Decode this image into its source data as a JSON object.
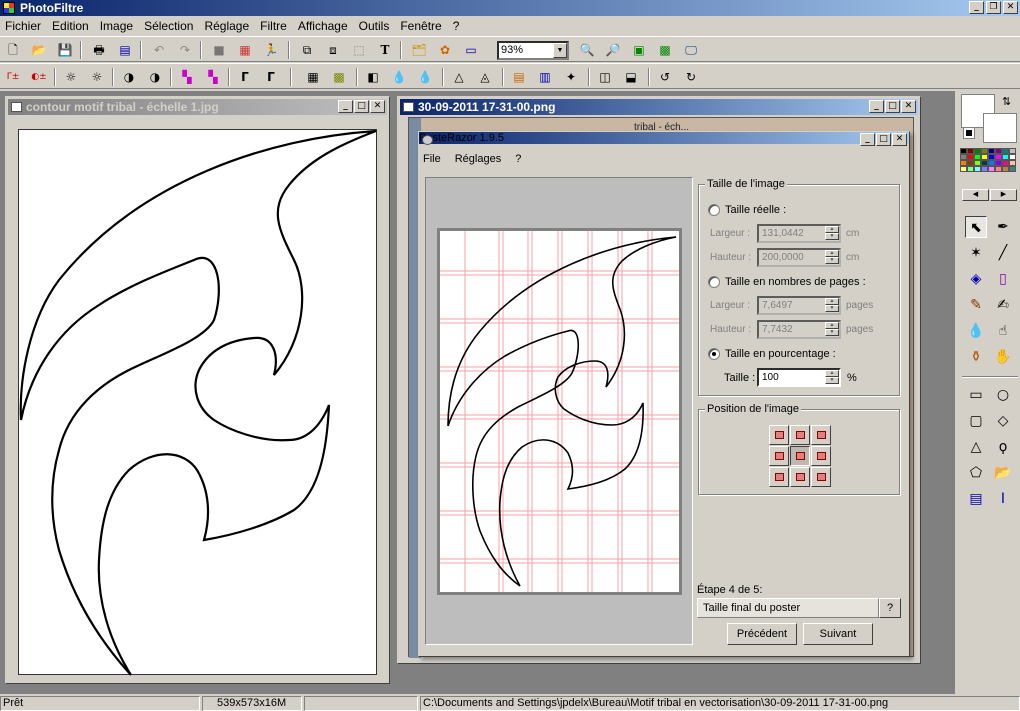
{
  "app": {
    "title": "PhotoFiltre"
  },
  "menu": [
    "Fichier",
    "Edition",
    "Image",
    "Sélection",
    "Réglage",
    "Filtre",
    "Affichage",
    "Outils",
    "Fenêtre",
    "?"
  ],
  "toolbar": {
    "zoom": "93%"
  },
  "windows": {
    "left": {
      "title": "contour motif tribal - échelle 1.jpg"
    },
    "right": {
      "title": "30-09-2011 17-31-00.png",
      "behind_text": "tribal - éch..."
    }
  },
  "posterazor": {
    "title": "PosteRazor 1.9.5",
    "menu": [
      "File",
      "Réglages",
      "?"
    ],
    "size_group": {
      "label": "Taille de l'image",
      "real_size": "Taille réelle :",
      "width_label": "Largeur :",
      "width_value": "131,0442",
      "width_unit": "cm",
      "height_label": "Hauteur :",
      "height_value": "200,0000",
      "height_unit": "cm",
      "pages_size": "Taille en nombres de pages :",
      "pages_width_label": "Largeur :",
      "pages_width_value": "7,6497",
      "pages_width_unit": "pages",
      "pages_height_label": "Hauteur :",
      "pages_height_value": "7,7432",
      "pages_height_unit": "pages",
      "percent_size": "Taille en pourcentage :",
      "percent_label": "Taille :",
      "percent_value": "100",
      "percent_unit": "%"
    },
    "position_group": {
      "label": "Position de l'image"
    },
    "step": {
      "label": "Étape 4 de 5:",
      "name": "Taille final du poster",
      "help": "?"
    },
    "buttons": {
      "prev": "Précédent",
      "next": "Suivant"
    }
  },
  "status": {
    "state": "Prêt",
    "size": "539x573x16M",
    "path": "C:\\Documents and Settings\\jpdelx\\Bureau\\Motif tribal en vectorisation\\30-09-2011 17-31-00.png"
  },
  "colors": {
    "accent": "#0a246a",
    "grid": "#f4a0a8"
  }
}
